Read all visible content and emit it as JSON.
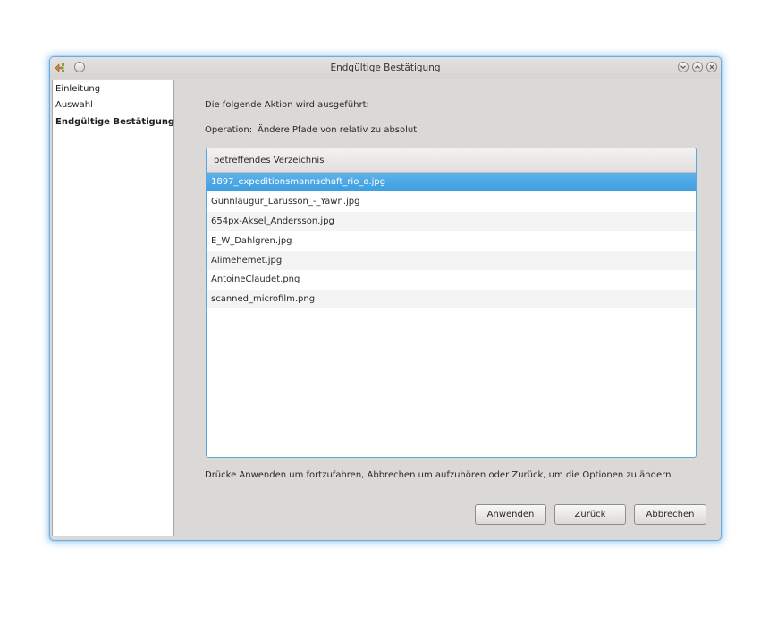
{
  "window": {
    "title": "Endgültige Bestätigung"
  },
  "sidebar": {
    "items": [
      {
        "label": "Einleitung",
        "active": false
      },
      {
        "label": "Auswahl",
        "active": false
      },
      {
        "label": "Endgültige Bestätigung",
        "active": true
      }
    ]
  },
  "main": {
    "intro": "Die folgende Aktion wird ausgeführt:",
    "operation_label": "Operation:",
    "operation_value": "Ändere Pfade von relativ zu absolut",
    "list": {
      "header": "betreffendes Verzeichnis",
      "selected_index": 0,
      "rows": [
        "1897_expeditionsmannschaft_rio_a.jpg",
        "Gunnlaugur_Larusson_-_Yawn.jpg",
        "654px-Aksel_Andersson.jpg",
        "E_W_Dahlgren.jpg",
        "Alimehemet.jpg",
        "AntoineClaudet.png",
        "scanned_microfilm.png"
      ]
    },
    "hint": "Drücke Anwenden um fortzufahren, Abbrechen um aufzuhören oder Zurück, um die Optionen zu ändern."
  },
  "buttons": {
    "apply": "Anwenden",
    "back": "Zurück",
    "cancel": "Abbrechen"
  },
  "icons": {
    "app": "gramps-app-icon",
    "window_menu": "window-menu-icon",
    "minimize": "minimize-icon",
    "maximize": "maximize-icon",
    "close": "close-icon"
  },
  "colors": {
    "accent": "#3c9ee0",
    "selection_text": "#ffffff",
    "window_bg": "#dbd9d7"
  }
}
